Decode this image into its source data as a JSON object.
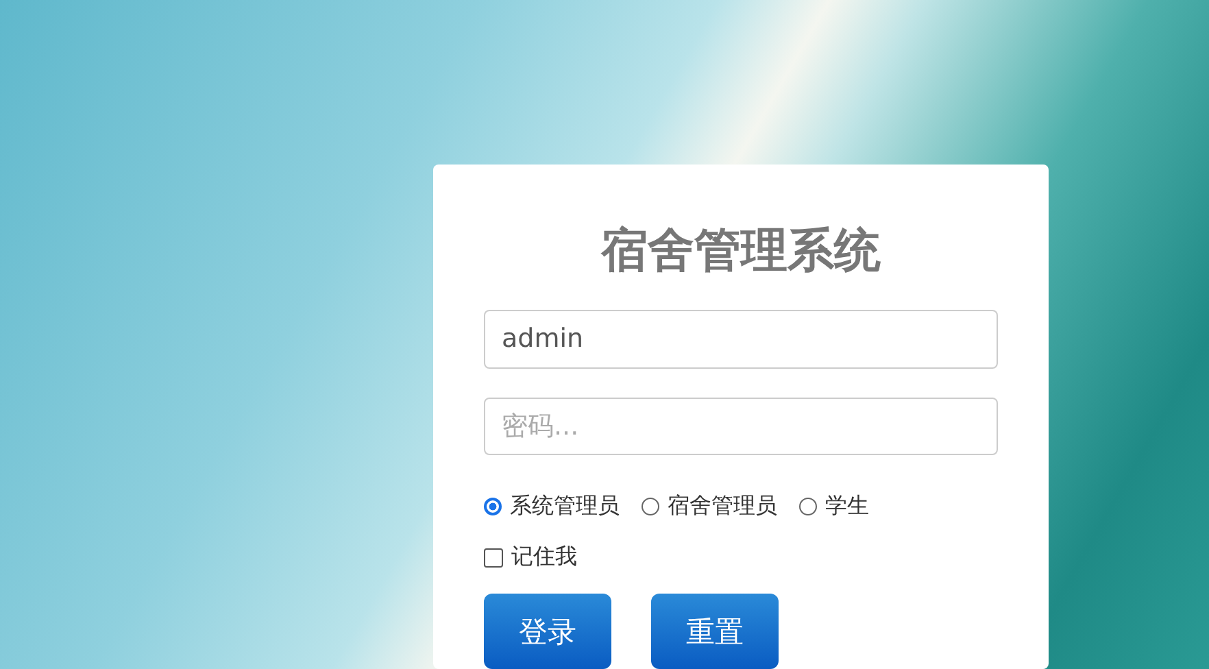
{
  "title": "宿舍管理系统",
  "username": {
    "value": "admin"
  },
  "password": {
    "placeholder": "密码..."
  },
  "roles": [
    {
      "label": "系统管理员",
      "selected": true
    },
    {
      "label": "宿舍管理员",
      "selected": false
    },
    {
      "label": "学生",
      "selected": false
    }
  ],
  "remember": {
    "label": "记住我",
    "checked": false
  },
  "buttons": [
    "登录",
    "重置"
  ]
}
